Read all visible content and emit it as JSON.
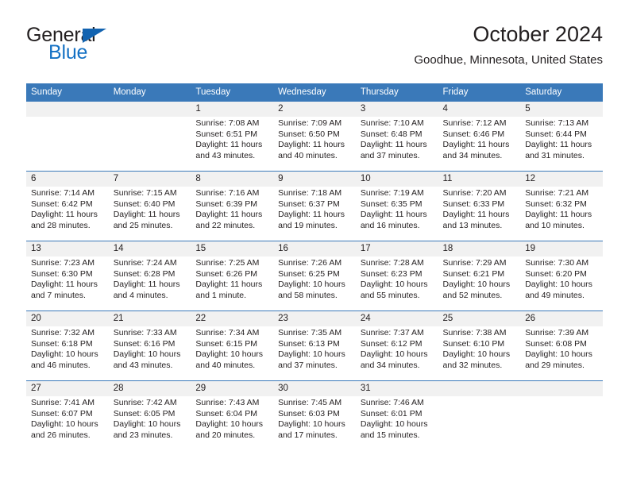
{
  "logo": {
    "word_one": "General",
    "word_two": "Blue",
    "triangle_icon": "triangle-icon",
    "primary_color": "#1471c4",
    "dark_color": "#231f20"
  },
  "header": {
    "title": "October 2024",
    "subtitle": "Goodhue, Minnesota, United States"
  },
  "calendar": {
    "accent_color": "#3a79b9",
    "daynum_band_color": "#f1f1f1",
    "weekday_headers": [
      "Sunday",
      "Monday",
      "Tuesday",
      "Wednesday",
      "Thursday",
      "Friday",
      "Saturday"
    ],
    "weeks": [
      [
        {
          "day": "",
          "sunrise": "",
          "sunset": "",
          "daylight_line1": "",
          "daylight_line2": "",
          "filled": false
        },
        {
          "day": "",
          "sunrise": "",
          "sunset": "",
          "daylight_line1": "",
          "daylight_line2": "",
          "filled": false
        },
        {
          "day": "1",
          "sunrise": "Sunrise: 7:08 AM",
          "sunset": "Sunset: 6:51 PM",
          "daylight_line1": "Daylight: 11 hours",
          "daylight_line2": "and 43 minutes.",
          "filled": true
        },
        {
          "day": "2",
          "sunrise": "Sunrise: 7:09 AM",
          "sunset": "Sunset: 6:50 PM",
          "daylight_line1": "Daylight: 11 hours",
          "daylight_line2": "and 40 minutes.",
          "filled": true
        },
        {
          "day": "3",
          "sunrise": "Sunrise: 7:10 AM",
          "sunset": "Sunset: 6:48 PM",
          "daylight_line1": "Daylight: 11 hours",
          "daylight_line2": "and 37 minutes.",
          "filled": true
        },
        {
          "day": "4",
          "sunrise": "Sunrise: 7:12 AM",
          "sunset": "Sunset: 6:46 PM",
          "daylight_line1": "Daylight: 11 hours",
          "daylight_line2": "and 34 minutes.",
          "filled": true
        },
        {
          "day": "5",
          "sunrise": "Sunrise: 7:13 AM",
          "sunset": "Sunset: 6:44 PM",
          "daylight_line1": "Daylight: 11 hours",
          "daylight_line2": "and 31 minutes.",
          "filled": true
        }
      ],
      [
        {
          "day": "6",
          "sunrise": "Sunrise: 7:14 AM",
          "sunset": "Sunset: 6:42 PM",
          "daylight_line1": "Daylight: 11 hours",
          "daylight_line2": "and 28 minutes.",
          "filled": true
        },
        {
          "day": "7",
          "sunrise": "Sunrise: 7:15 AM",
          "sunset": "Sunset: 6:40 PM",
          "daylight_line1": "Daylight: 11 hours",
          "daylight_line2": "and 25 minutes.",
          "filled": true
        },
        {
          "day": "8",
          "sunrise": "Sunrise: 7:16 AM",
          "sunset": "Sunset: 6:39 PM",
          "daylight_line1": "Daylight: 11 hours",
          "daylight_line2": "and 22 minutes.",
          "filled": true
        },
        {
          "day": "9",
          "sunrise": "Sunrise: 7:18 AM",
          "sunset": "Sunset: 6:37 PM",
          "daylight_line1": "Daylight: 11 hours",
          "daylight_line2": "and 19 minutes.",
          "filled": true
        },
        {
          "day": "10",
          "sunrise": "Sunrise: 7:19 AM",
          "sunset": "Sunset: 6:35 PM",
          "daylight_line1": "Daylight: 11 hours",
          "daylight_line2": "and 16 minutes.",
          "filled": true
        },
        {
          "day": "11",
          "sunrise": "Sunrise: 7:20 AM",
          "sunset": "Sunset: 6:33 PM",
          "daylight_line1": "Daylight: 11 hours",
          "daylight_line2": "and 13 minutes.",
          "filled": true
        },
        {
          "day": "12",
          "sunrise": "Sunrise: 7:21 AM",
          "sunset": "Sunset: 6:32 PM",
          "daylight_line1": "Daylight: 11 hours",
          "daylight_line2": "and 10 minutes.",
          "filled": true
        }
      ],
      [
        {
          "day": "13",
          "sunrise": "Sunrise: 7:23 AM",
          "sunset": "Sunset: 6:30 PM",
          "daylight_line1": "Daylight: 11 hours",
          "daylight_line2": "and 7 minutes.",
          "filled": true
        },
        {
          "day": "14",
          "sunrise": "Sunrise: 7:24 AM",
          "sunset": "Sunset: 6:28 PM",
          "daylight_line1": "Daylight: 11 hours",
          "daylight_line2": "and 4 minutes.",
          "filled": true
        },
        {
          "day": "15",
          "sunrise": "Sunrise: 7:25 AM",
          "sunset": "Sunset: 6:26 PM",
          "daylight_line1": "Daylight: 11 hours",
          "daylight_line2": "and 1 minute.",
          "filled": true
        },
        {
          "day": "16",
          "sunrise": "Sunrise: 7:26 AM",
          "sunset": "Sunset: 6:25 PM",
          "daylight_line1": "Daylight: 10 hours",
          "daylight_line2": "and 58 minutes.",
          "filled": true
        },
        {
          "day": "17",
          "sunrise": "Sunrise: 7:28 AM",
          "sunset": "Sunset: 6:23 PM",
          "daylight_line1": "Daylight: 10 hours",
          "daylight_line2": "and 55 minutes.",
          "filled": true
        },
        {
          "day": "18",
          "sunrise": "Sunrise: 7:29 AM",
          "sunset": "Sunset: 6:21 PM",
          "daylight_line1": "Daylight: 10 hours",
          "daylight_line2": "and 52 minutes.",
          "filled": true
        },
        {
          "day": "19",
          "sunrise": "Sunrise: 7:30 AM",
          "sunset": "Sunset: 6:20 PM",
          "daylight_line1": "Daylight: 10 hours",
          "daylight_line2": "and 49 minutes.",
          "filled": true
        }
      ],
      [
        {
          "day": "20",
          "sunrise": "Sunrise: 7:32 AM",
          "sunset": "Sunset: 6:18 PM",
          "daylight_line1": "Daylight: 10 hours",
          "daylight_line2": "and 46 minutes.",
          "filled": true
        },
        {
          "day": "21",
          "sunrise": "Sunrise: 7:33 AM",
          "sunset": "Sunset: 6:16 PM",
          "daylight_line1": "Daylight: 10 hours",
          "daylight_line2": "and 43 minutes.",
          "filled": true
        },
        {
          "day": "22",
          "sunrise": "Sunrise: 7:34 AM",
          "sunset": "Sunset: 6:15 PM",
          "daylight_line1": "Daylight: 10 hours",
          "daylight_line2": "and 40 minutes.",
          "filled": true
        },
        {
          "day": "23",
          "sunrise": "Sunrise: 7:35 AM",
          "sunset": "Sunset: 6:13 PM",
          "daylight_line1": "Daylight: 10 hours",
          "daylight_line2": "and 37 minutes.",
          "filled": true
        },
        {
          "day": "24",
          "sunrise": "Sunrise: 7:37 AM",
          "sunset": "Sunset: 6:12 PM",
          "daylight_line1": "Daylight: 10 hours",
          "daylight_line2": "and 34 minutes.",
          "filled": true
        },
        {
          "day": "25",
          "sunrise": "Sunrise: 7:38 AM",
          "sunset": "Sunset: 6:10 PM",
          "daylight_line1": "Daylight: 10 hours",
          "daylight_line2": "and 32 minutes.",
          "filled": true
        },
        {
          "day": "26",
          "sunrise": "Sunrise: 7:39 AM",
          "sunset": "Sunset: 6:08 PM",
          "daylight_line1": "Daylight: 10 hours",
          "daylight_line2": "and 29 minutes.",
          "filled": true
        }
      ],
      [
        {
          "day": "27",
          "sunrise": "Sunrise: 7:41 AM",
          "sunset": "Sunset: 6:07 PM",
          "daylight_line1": "Daylight: 10 hours",
          "daylight_line2": "and 26 minutes.",
          "filled": true
        },
        {
          "day": "28",
          "sunrise": "Sunrise: 7:42 AM",
          "sunset": "Sunset: 6:05 PM",
          "daylight_line1": "Daylight: 10 hours",
          "daylight_line2": "and 23 minutes.",
          "filled": true
        },
        {
          "day": "29",
          "sunrise": "Sunrise: 7:43 AM",
          "sunset": "Sunset: 6:04 PM",
          "daylight_line1": "Daylight: 10 hours",
          "daylight_line2": "and 20 minutes.",
          "filled": true
        },
        {
          "day": "30",
          "sunrise": "Sunrise: 7:45 AM",
          "sunset": "Sunset: 6:03 PM",
          "daylight_line1": "Daylight: 10 hours",
          "daylight_line2": "and 17 minutes.",
          "filled": true
        },
        {
          "day": "31",
          "sunrise": "Sunrise: 7:46 AM",
          "sunset": "Sunset: 6:01 PM",
          "daylight_line1": "Daylight: 10 hours",
          "daylight_line2": "and 15 minutes.",
          "filled": true
        },
        {
          "day": "",
          "sunrise": "",
          "sunset": "",
          "daylight_line1": "",
          "daylight_line2": "",
          "filled": false
        },
        {
          "day": "",
          "sunrise": "",
          "sunset": "",
          "daylight_line1": "",
          "daylight_line2": "",
          "filled": false
        }
      ]
    ]
  }
}
